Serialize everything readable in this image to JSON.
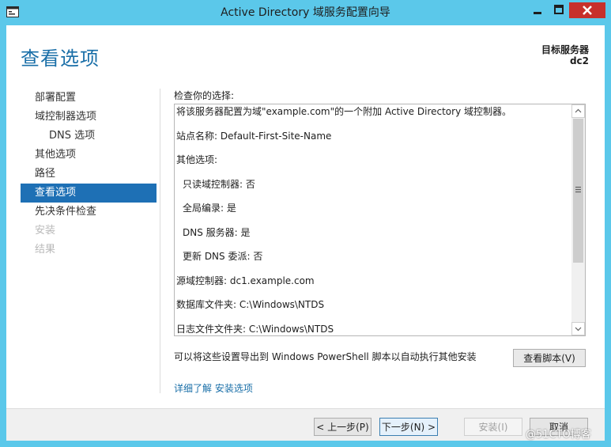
{
  "window": {
    "title": "Active Directory 域服务配置向导"
  },
  "header": {
    "page_title": "查看选项",
    "target_label": "目标服务器",
    "target_name": "dc2"
  },
  "nav": {
    "items": [
      {
        "label": "部署配置",
        "state": "normal"
      },
      {
        "label": "域控制器选项",
        "state": "normal"
      },
      {
        "label": "DNS 选项",
        "state": "normal"
      },
      {
        "label": "其他选项",
        "state": "normal"
      },
      {
        "label": "路径",
        "state": "normal"
      },
      {
        "label": "查看选项",
        "state": "active"
      },
      {
        "label": "先决条件检查",
        "state": "normal"
      },
      {
        "label": "安装",
        "state": "disabled"
      },
      {
        "label": "结果",
        "state": "disabled"
      }
    ]
  },
  "review": {
    "label": "检查你的选择:",
    "lines": [
      "将该服务器配置为域\"example.com\"的一个附加 Active Directory 域控制器。",
      "站点名称: Default-First-Site-Name",
      "其他选项:",
      "只读域控制器: 否",
      "全局编录: 是",
      "DNS 服务器: 是",
      "更新 DNS 委派: 否",
      "源域控制器: dc1.example.com",
      "数据库文件夹: C:\\Windows\\NTDS",
      "日志文件文件夹: C:\\Windows\\NTDS"
    ]
  },
  "export": {
    "text": "可以将这些设置导出到 Windows PowerShell 脚本以自动执行其他安装",
    "button": "查看脚本(V)"
  },
  "learn_more": "详细了解 安装选项",
  "footer": {
    "prev": "< 上一步(P)",
    "next": "下一步(N) >",
    "install": "安装(I)",
    "cancel": "取消"
  },
  "watermark": "@51CTO博客",
  "colors": {
    "titlebar": "#5bc8ea",
    "accent": "#1e70b5",
    "link": "#1a6fa8",
    "close": "#c7302b"
  }
}
